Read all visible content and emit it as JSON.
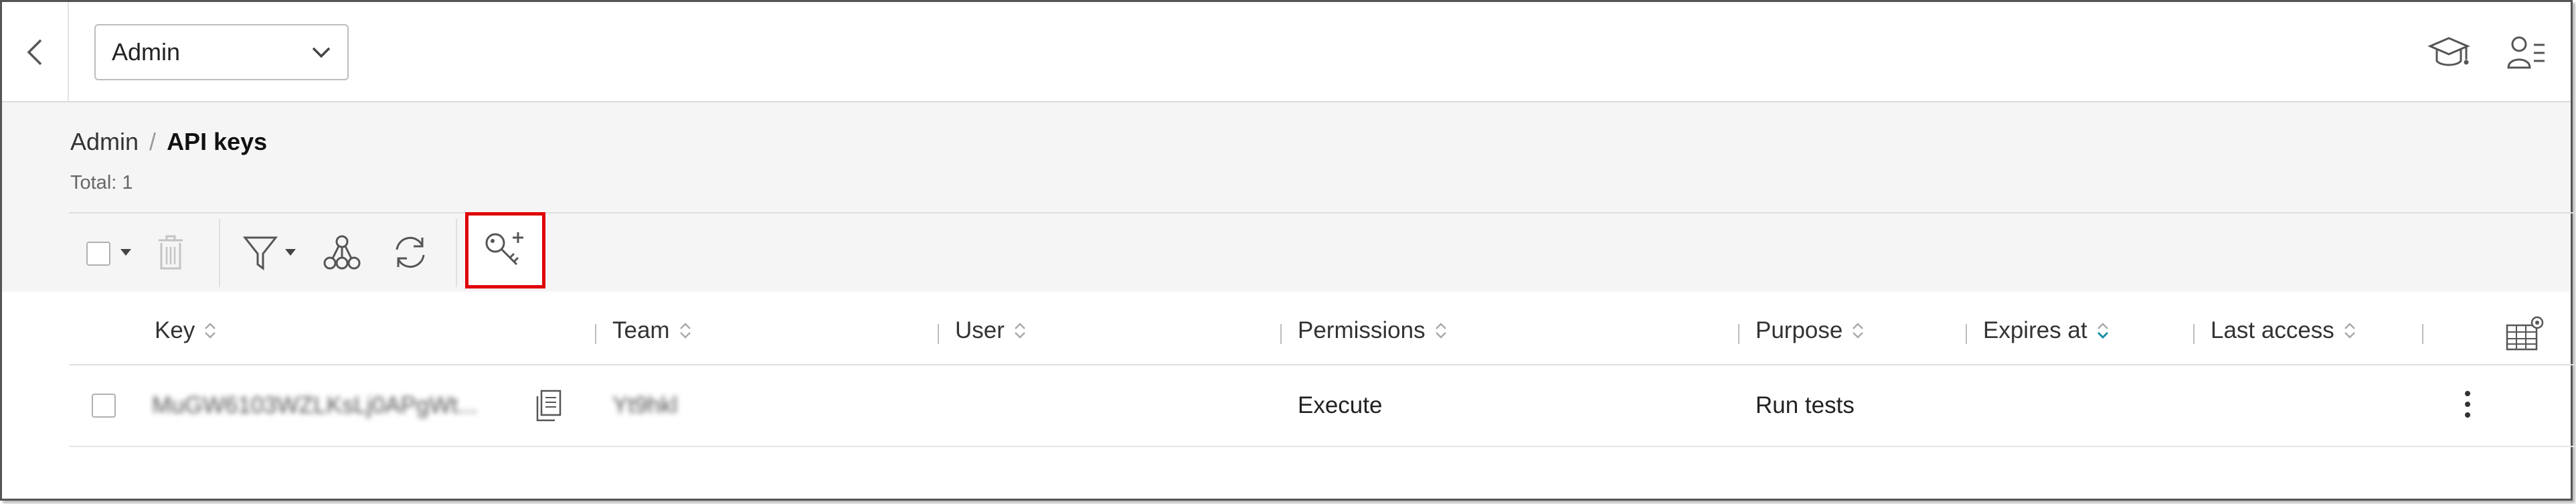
{
  "topbar": {
    "back_icon": "chevron-left-icon",
    "workspace_select": {
      "value": "Admin",
      "icon": "chevron-down-icon"
    },
    "right_icons": [
      "graduation-cap-icon",
      "user-list-icon"
    ]
  },
  "breadcrumb": {
    "root": "Admin",
    "separator": "/",
    "current": "API keys"
  },
  "summary": {
    "total_label": "Total: 1"
  },
  "toolbar": {
    "icons": [
      "checkbox",
      "caret-down-icon",
      "trash-icon",
      "filter-icon",
      "caret-down-icon",
      "nodes-icon",
      "refresh-icon",
      "key-plus-icon"
    ],
    "highlighted": "key-plus-icon"
  },
  "table": {
    "columns": [
      {
        "label": "Key",
        "sort": "none"
      },
      {
        "label": "Team",
        "sort": "none"
      },
      {
        "label": "User",
        "sort": "none"
      },
      {
        "label": "Permissions",
        "sort": "none"
      },
      {
        "label": "Purpose",
        "sort": "none"
      },
      {
        "label": "Expires at",
        "sort": "descending"
      },
      {
        "label": "Last access",
        "sort": "none"
      }
    ],
    "settings_icon": "table-settings-icon",
    "rows": [
      {
        "key": "MuGW6103WZLKsLj0APgWt...",
        "team": "Yt9hkl",
        "user": "",
        "permissions": "Execute",
        "purpose": "Run tests",
        "expires_at": "",
        "last_access": ""
      }
    ]
  },
  "colors": {
    "highlight": "#e00000",
    "sort_active": "#1a8fa6",
    "header_bg": "#f5f5f5"
  }
}
